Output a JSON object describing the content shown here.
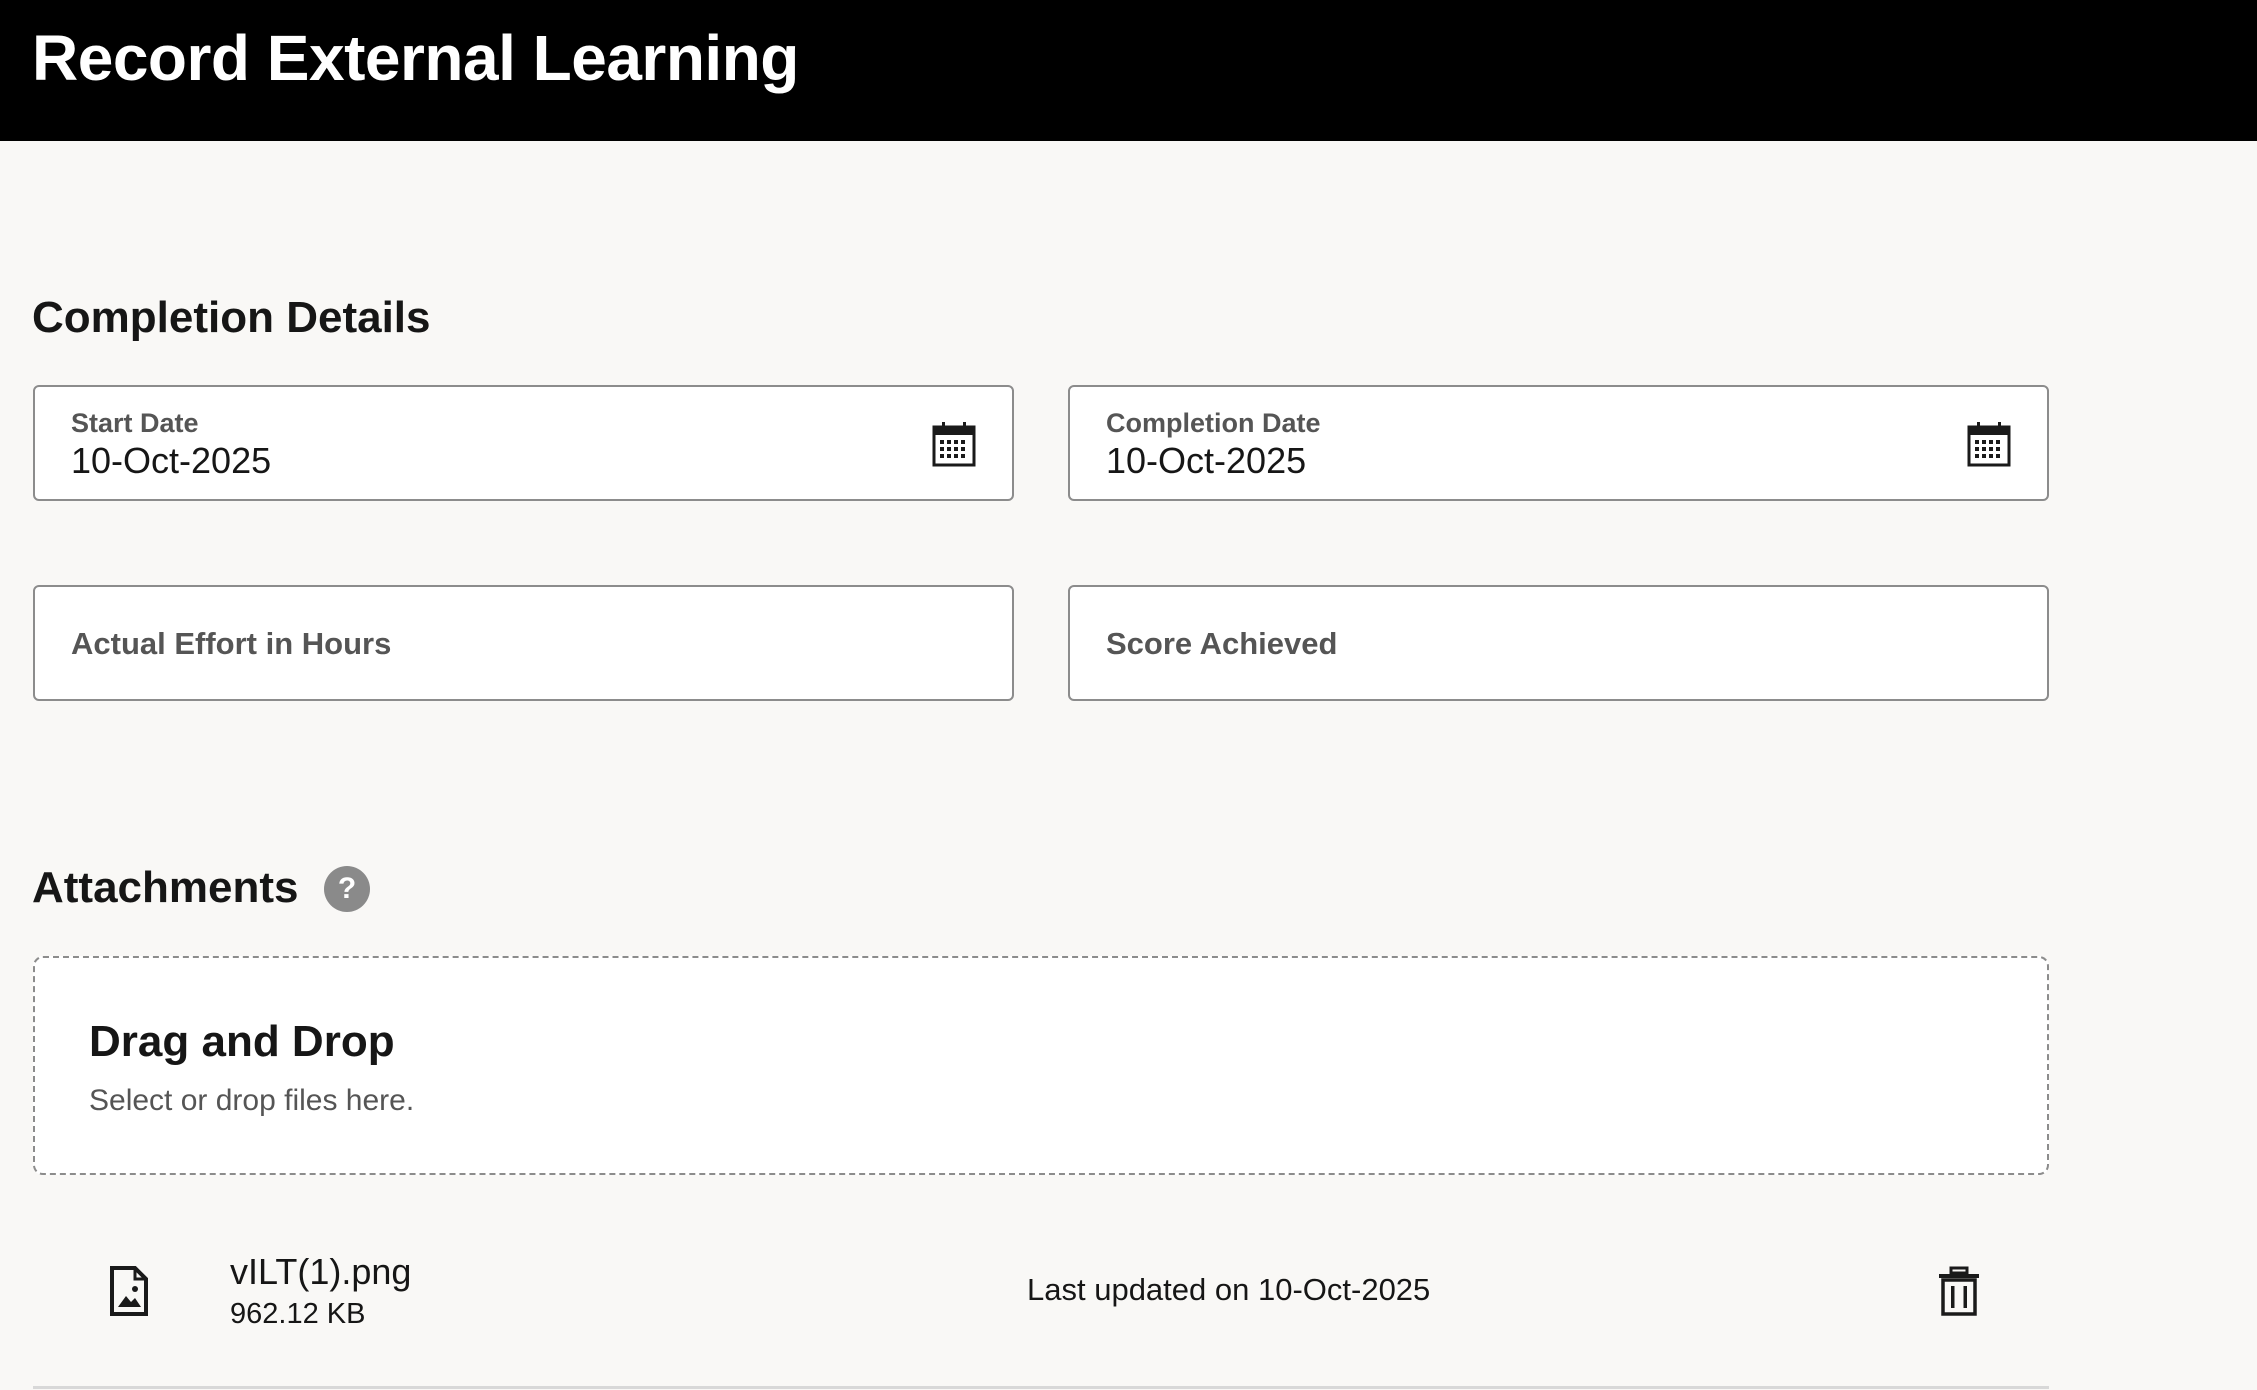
{
  "header": {
    "title": "Record External Learning"
  },
  "completion_details": {
    "title": "Completion Details",
    "start_date": {
      "label": "Start Date",
      "value": "10-Oct-2025",
      "icon": "calendar-icon"
    },
    "completion_date": {
      "label": "Completion Date",
      "value": "10-Oct-2025",
      "icon": "calendar-icon"
    },
    "actual_effort": {
      "placeholder": "Actual Effort in Hours",
      "value": ""
    },
    "score_achieved": {
      "placeholder": "Score Achieved",
      "value": ""
    }
  },
  "attachments": {
    "title": "Attachments",
    "help_icon": "help-icon",
    "help_glyph": "?",
    "dropzone": {
      "title": "Drag and Drop",
      "hint": "Select or drop files here."
    },
    "files": [
      {
        "name": "vILT(1).png",
        "size": "962.12 KB",
        "updated": "Last updated on 10-Oct-2025",
        "icon": "image-file-icon",
        "action_icon": "trash-icon"
      }
    ]
  },
  "colors": {
    "header_bg": "#000000",
    "page_bg": "#f9f8f6",
    "border": "#8c8c8c",
    "help_bg": "#8a8a8a"
  }
}
